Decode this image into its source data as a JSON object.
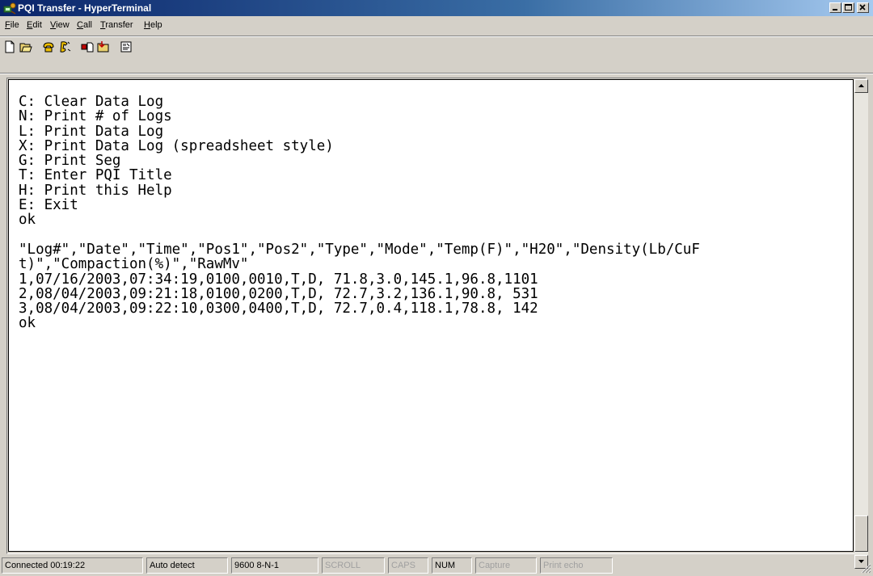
{
  "window": {
    "title": "PQI Transfer - HyperTerminal",
    "title_bar_color": "#0a246a"
  },
  "menu": [
    {
      "label": "File",
      "accel": "F",
      "rest": "ile"
    },
    {
      "label": "Edit",
      "accel": "E",
      "rest": "dit"
    },
    {
      "label": "View",
      "accel": "V",
      "rest": "iew"
    },
    {
      "label": "Call",
      "accel": "C",
      "rest": "all"
    },
    {
      "label": "Transfer",
      "accel": "T",
      "rest": "ransfer"
    },
    {
      "label": "Help",
      "accel": "H",
      "rest": "elp"
    }
  ],
  "toolbar": {
    "buttons": [
      "new-icon",
      "open-icon",
      "connect-icon",
      "disconnect-icon",
      "send-icon",
      "receive-icon",
      "properties-icon"
    ]
  },
  "terminal": {
    "lines": [
      "C: Clear Data Log",
      "N: Print # of Logs",
      "L: Print Data Log",
      "X: Print Data Log (spreadsheet style)",
      "G: Print Seg",
      "T: Enter PQI Title",
      "H: Print this Help",
      "E: Exit",
      "ok",
      "",
      "\"Log#\",\"Date\",\"Time\",\"Pos1\",\"Pos2\",\"Type\",\"Mode\",\"Temp(F)\",\"H20\",\"Density(Lb/CuF",
      "t)\",\"Compaction(%)\",\"RawMv\"",
      "1,07/16/2003,07:34:19,0100,0010,T,D, 71.8,3.0,145.1,96.8,1101",
      "2,08/04/2003,09:21:18,0100,0200,T,D, 72.7,3.2,136.1,90.8, 531",
      "3,08/04/2003,09:22:10,0300,0400,T,D, 72.7,0.4,118.1,78.8, 142",
      "ok"
    ]
  },
  "status": {
    "connected": "Connected 00:19:22",
    "detect": "Auto detect",
    "settings": "9600 8-N-1",
    "scroll": "SCROLL",
    "caps": "CAPS",
    "num": "NUM",
    "capture": "Capture",
    "print_echo": "Print echo"
  }
}
